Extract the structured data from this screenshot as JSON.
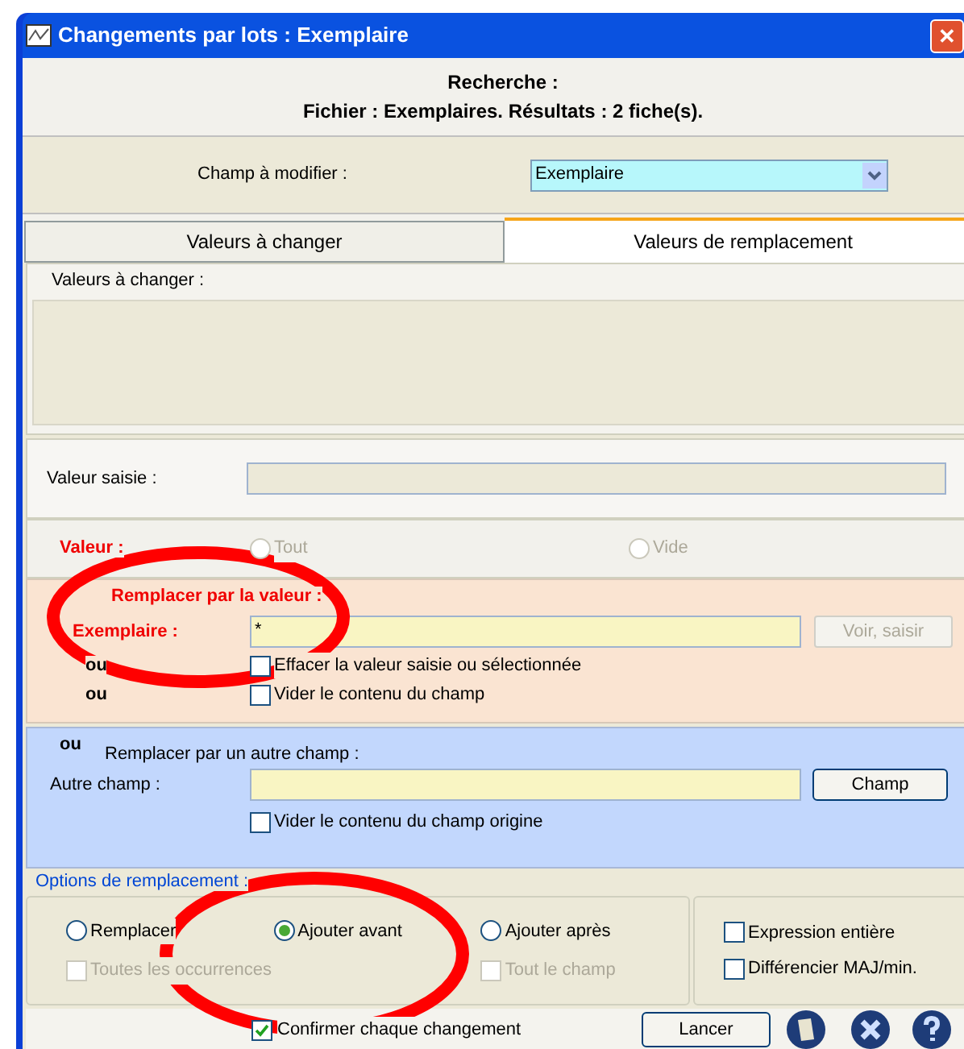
{
  "window": {
    "title": "Changements par lots : Exemplaire",
    "close": "✕"
  },
  "header": {
    "line1": "Recherche :",
    "line2": "Fichier : Exemplaires. Résultats : 2 fiche(s)."
  },
  "field_to_modify": {
    "label": "Champ à modifier :",
    "value": "Exemplaire"
  },
  "tabs": [
    {
      "label": "Valeurs à changer",
      "selected": false
    },
    {
      "label": "Valeurs de remplacement",
      "selected": true
    }
  ],
  "values_to_change": {
    "label": "Valeurs à changer :"
  },
  "typed_value": {
    "label": "Valeur saisie :"
  },
  "value_options": {
    "label": "Valeur :",
    "radios": [
      {
        "label": "Tout",
        "selected": false,
        "disabled": true
      },
      {
        "label": "Vide",
        "selected": false,
        "disabled": true
      }
    ]
  },
  "replace_by_value": {
    "title": "Remplacer par la valeur :",
    "label": "Exemplaire :",
    "value": "*",
    "button": "Voir, saisir",
    "button_disabled": true,
    "options": [
      {
        "prefix": "ou",
        "label": "Effacer la valeur saisie ou sélectionnée",
        "checked": false
      },
      {
        "prefix": "ou",
        "label": "Vider le contenu du champ",
        "checked": false
      }
    ]
  },
  "replace_by_field": {
    "prefix": "ou",
    "title": "Remplacer par un autre champ :",
    "label": "Autre champ :",
    "button": "Champ",
    "option": {
      "label": "Vider le contenu du champ origine",
      "checked": false
    }
  },
  "replace_options": {
    "title": "Options de remplacement :",
    "modes": [
      {
        "label": "Remplacer",
        "selected": false,
        "sub": {
          "label": "Toutes les occurrences",
          "checked": false,
          "disabled": true
        }
      },
      {
        "label": "Ajouter avant",
        "selected": true
      },
      {
        "label": "Ajouter après",
        "selected": false,
        "sub": {
          "label": "Tout le champ",
          "checked": false,
          "disabled": true
        }
      }
    ],
    "flags": [
      {
        "label": "Expression entière",
        "checked": false
      },
      {
        "label": "Différencier MAJ/min.",
        "checked": false
      }
    ]
  },
  "footer": {
    "confirm": {
      "label": "Confirmer chaque changement",
      "checked": true
    },
    "button": "Lancer"
  }
}
